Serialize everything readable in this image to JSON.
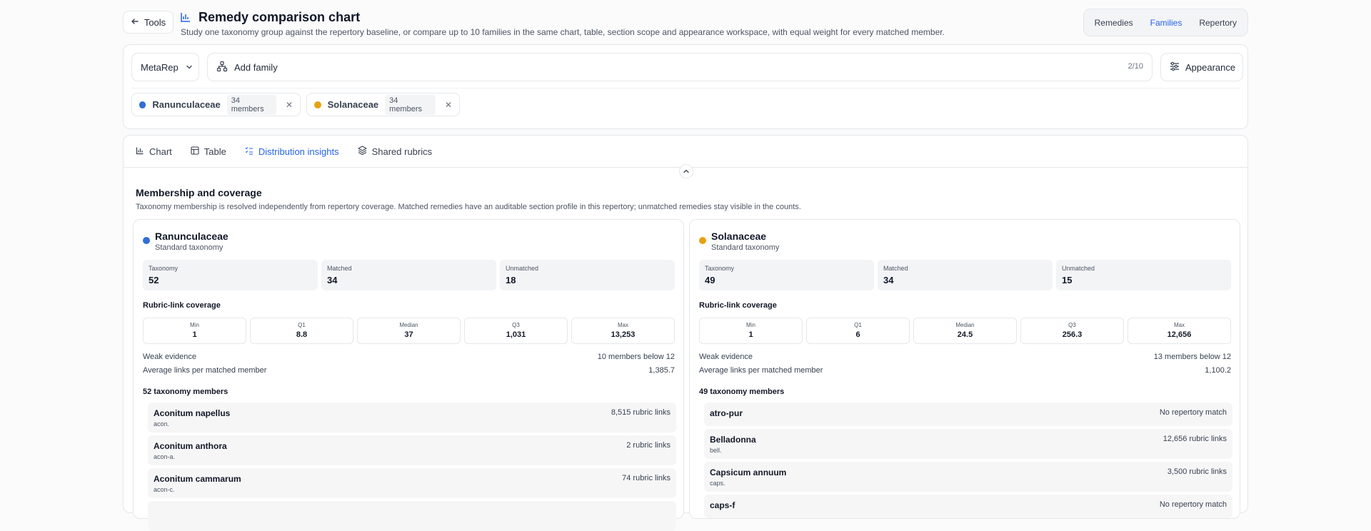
{
  "header": {
    "back_label": "Tools",
    "title": "Remedy comparison chart",
    "subtitle": "Study one taxonomy group against the repertory baseline, or compare up to 10 families in the same chart, table, section scope and appearance workspace, with equal weight for every matched member.",
    "segments": [
      "Remedies",
      "Families",
      "Repertory"
    ],
    "active_segment": "Families"
  },
  "controls": {
    "repertory": "MetaRep",
    "add_family": "Add family",
    "count": "2/10",
    "appearance": "Appearance"
  },
  "chips": [
    {
      "name": "Ranunculaceae",
      "badge": "34 members",
      "color": "#2f6fd6"
    },
    {
      "name": "Solanaceae",
      "badge": "34 members",
      "color": "#e6a213"
    }
  ],
  "tabs": [
    "Chart",
    "Table",
    "Distribution insights",
    "Shared rubrics"
  ],
  "active_tab": "Distribution insights",
  "section": {
    "title": "Membership and coverage",
    "subtitle": "Taxonomy membership is resolved independently from repertory coverage. Matched remedies have an auditable section profile in this repertory; unmatched remedies stay visible in the counts."
  },
  "panels": [
    {
      "name": "Ranunculaceae",
      "taxonomy_type": "Standard taxonomy",
      "color": "#2f6fd6",
      "stats": [
        {
          "label": "Taxonomy",
          "value": "52"
        },
        {
          "label": "Matched",
          "value": "34"
        },
        {
          "label": "Unmatched",
          "value": "18"
        }
      ],
      "coverage_title": "Rubric-link coverage",
      "quartiles": [
        {
          "label": "Min",
          "value": "1"
        },
        {
          "label": "Q1",
          "value": "8.8"
        },
        {
          "label": "Median",
          "value": "37"
        },
        {
          "label": "Q3",
          "value": "1,031"
        },
        {
          "label": "Max",
          "value": "13,253"
        }
      ],
      "weak_label": "Weak evidence",
      "weak_value": "10 members below 12",
      "avg_label": "Average links per matched member",
      "avg_value": "1,385.7",
      "members_title": "52 taxonomy members",
      "members": [
        {
          "name": "Aconitum napellus",
          "abbr": "acon.",
          "links": "8,515 rubric links"
        },
        {
          "name": "Aconitum anthora",
          "abbr": "acon-a.",
          "links": "2 rubric links"
        },
        {
          "name": "Aconitum cammarum",
          "abbr": "acon-c.",
          "links": "74 rubric links"
        }
      ]
    },
    {
      "name": "Solanaceae",
      "taxonomy_type": "Standard taxonomy",
      "color": "#e6a213",
      "stats": [
        {
          "label": "Taxonomy",
          "value": "49"
        },
        {
          "label": "Matched",
          "value": "34"
        },
        {
          "label": "Unmatched",
          "value": "15"
        }
      ],
      "coverage_title": "Rubric-link coverage",
      "quartiles": [
        {
          "label": "Min",
          "value": "1"
        },
        {
          "label": "Q1",
          "value": "6"
        },
        {
          "label": "Median",
          "value": "24.5"
        },
        {
          "label": "Q3",
          "value": "256.3"
        },
        {
          "label": "Max",
          "value": "12,656"
        }
      ],
      "weak_label": "Weak evidence",
      "weak_value": "13 members below 12",
      "avg_label": "Average links per matched member",
      "avg_value": "1,100.2",
      "members_title": "49 taxonomy members",
      "members": [
        {
          "name": "atro-pur",
          "abbr": "",
          "links": "No repertory match"
        },
        {
          "name": "Belladonna",
          "abbr": "bell.",
          "links": "12,656 rubric links"
        },
        {
          "name": "Capsicum annuum",
          "abbr": "caps.",
          "links": "3,500 rubric links"
        },
        {
          "name": "caps-f",
          "abbr": "",
          "links": "No repertory match"
        }
      ]
    }
  ]
}
